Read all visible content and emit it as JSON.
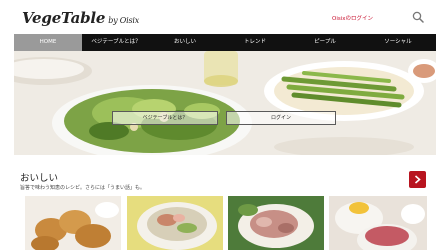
{
  "header": {
    "logo_main": "VegeTable",
    "logo_by": "by Oisix",
    "login_link": "Oisixのログイン"
  },
  "nav": {
    "items": [
      {
        "label": "HOME",
        "active": true
      },
      {
        "label": "ベジテーブルとは？",
        "active": false
      },
      {
        "label": "おいしい",
        "active": false
      },
      {
        "label": "トレンド",
        "active": false
      },
      {
        "label": "ピープル",
        "active": false
      },
      {
        "label": "ソーシャル",
        "active": false
      }
    ]
  },
  "hero": {
    "about_button": "ベジテーブルとは？",
    "login_button": "ログイン"
  },
  "section": {
    "title": "おいしい",
    "subtitle": "旨答で味わう知恵のレシピ。さらには「うまい話」も。"
  },
  "colors": {
    "accent": "#b8141f",
    "nav_bg": "#111111",
    "nav_active": "#9a9a9a"
  }
}
